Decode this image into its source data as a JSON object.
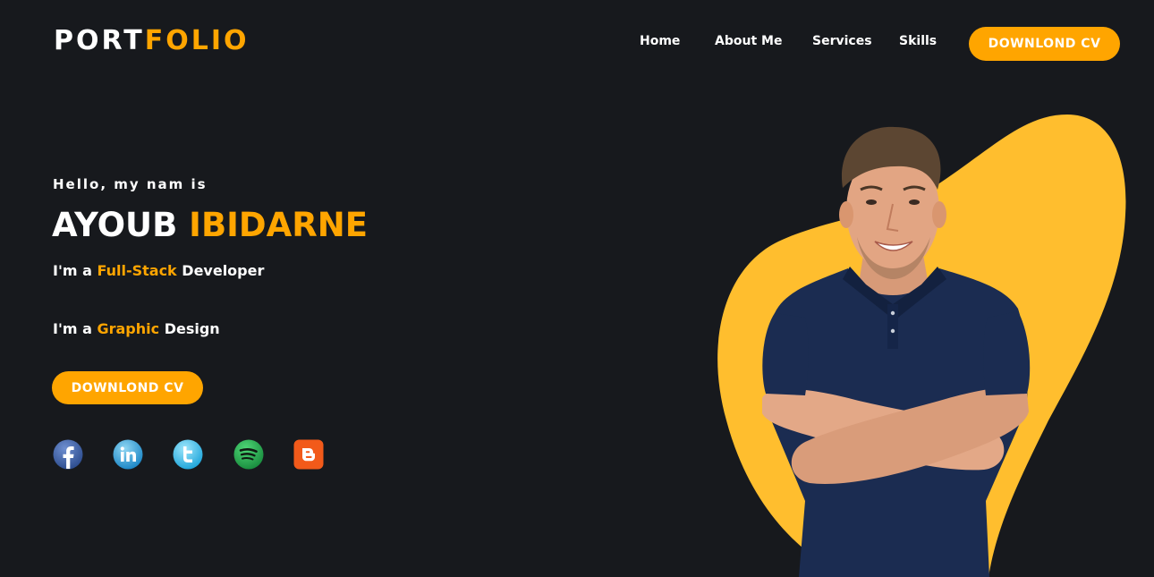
{
  "header": {
    "logo_part1": "PORT",
    "logo_part2": "FOLIO",
    "nav": [
      "Home",
      "About Me",
      "Services",
      "Skills"
    ],
    "cta": "DOWNLOND CV"
  },
  "hero": {
    "greeting": "Hello, my nam is",
    "first_name": "AYOUB",
    "last_name": "IBIDARNE",
    "role1_prefix": "I'm a",
    "role1_highlight": "Full-Stack",
    "role1_suffix": "Developer",
    "role2_prefix": "I'm a",
    "role2_highlight": "Graphic",
    "role2_suffix": "Design",
    "cta": "DOWNLOND CV"
  },
  "socials": [
    "facebook-icon",
    "linkedin-icon",
    "twitter-icon",
    "spotify-icon",
    "blogger-icon"
  ],
  "colors": {
    "background": "#17191d",
    "accent": "#ffa500",
    "blob": "#ffbe2e",
    "text": "#ffffff"
  }
}
